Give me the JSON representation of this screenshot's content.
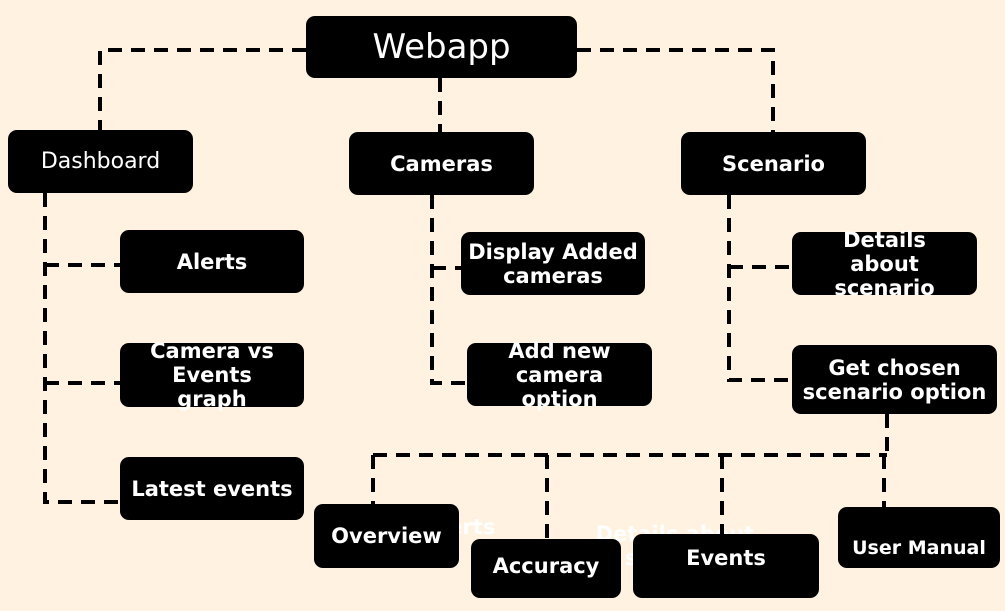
{
  "root": {
    "label": "Webapp"
  },
  "branches": [
    {
      "label": "Dashboard",
      "children": [
        "Alerts",
        "Camera vs Events graph",
        "Latest events"
      ]
    },
    {
      "label": "Cameras",
      "children": [
        "Display Added cameras",
        "Add new camera option"
      ]
    },
    {
      "label": "Scenario",
      "children": [
        "Details about scenario",
        "Get chosen scenario option"
      ]
    }
  ],
  "scenario_option_children": [
    "Overview",
    "Accuracy",
    "Events",
    "User Manual"
  ],
  "ghost_text": [
    "Alerts",
    "Details about scenario"
  ],
  "colors": {
    "background": "#fff2e0",
    "box": "#000000",
    "text": "#ffffff",
    "line": "#000000"
  }
}
